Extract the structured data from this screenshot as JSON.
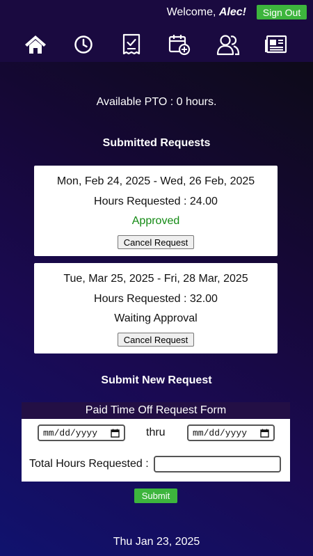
{
  "header": {
    "welcome_prefix": "Welcome, ",
    "user_name": "Alec!",
    "signout_label": "Sign Out"
  },
  "nav": {
    "icons": [
      "home-icon",
      "clock-icon",
      "receipt-check-icon",
      "calendar-add-icon",
      "users-icon",
      "newspaper-icon"
    ]
  },
  "pto": {
    "available_text": "Available PTO : 0 hours."
  },
  "submitted": {
    "title": "Submitted Requests",
    "requests": [
      {
        "dates": "Mon, Feb 24, 2025 - Wed, 26 Feb, 2025",
        "hours": "Hours Requested : 24.00",
        "status": "Approved",
        "cancel_label": "Cancel Request"
      },
      {
        "dates": "Tue, Mar 25, 2025 - Fri, 28 Mar, 2025",
        "hours": "Hours Requested : 32.00",
        "status": "Waiting Approval",
        "cancel_label": "Cancel Request"
      }
    ]
  },
  "new_request": {
    "title": "Submit New Request",
    "form_title": "Paid Time Off Request Form",
    "start_placeholder": "mm/dd/yyyy",
    "thru_label": "thru",
    "end_placeholder": "mm/dd/yyyy",
    "total_label": "Total Hours Requested :",
    "total_value": "",
    "submit_label": "Submit"
  },
  "footer": {
    "date": "Thu Jan 23, 2025"
  },
  "colors": {
    "accent_green": "#3db53d",
    "approved_green": "#138a13",
    "header_bg": "#1a0a40"
  }
}
